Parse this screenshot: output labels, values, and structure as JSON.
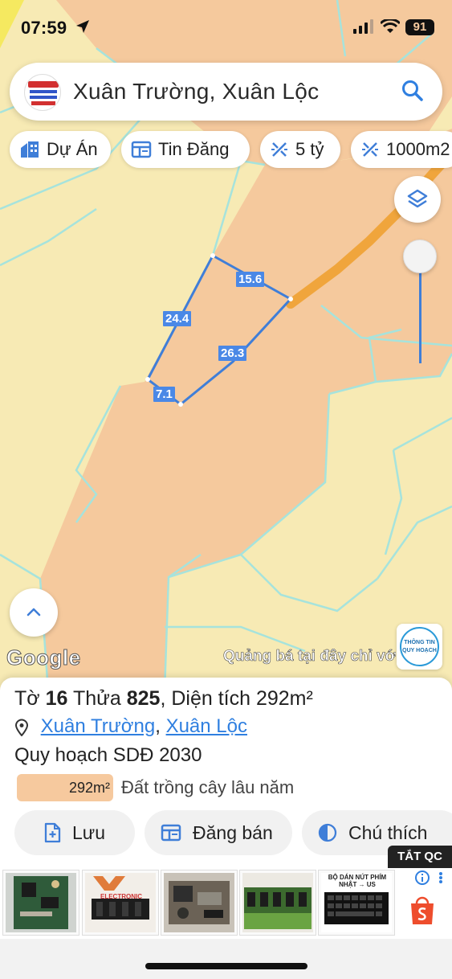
{
  "status_bar": {
    "time": "07:59",
    "battery": "91"
  },
  "search": {
    "title": "Xuân Trường, Xuân Lộc"
  },
  "chips": [
    {
      "label": "Dự Án",
      "icon": "building-icon"
    },
    {
      "label": "Tin Đăng",
      "icon": "newspaper-icon"
    },
    {
      "label": "5 tỷ",
      "icon": "price-filter-icon"
    },
    {
      "label": "1000m2",
      "icon": "area-filter-icon"
    }
  ],
  "map": {
    "edge_labels": [
      "15.6",
      "24.4",
      "26.3",
      "7.1"
    ],
    "attribution": "Google",
    "promo": "Quảng bá tại đây chỉ với",
    "info_button": {
      "line1": "THÔNG TIN",
      "line2": "QUY HOẠCH"
    },
    "colors": {
      "land": "#f5c99d",
      "background": "#f7eab4",
      "road": "#f0a53c",
      "parcel_edge": "#3f7ed8",
      "boundary": "#a6e3dc"
    }
  },
  "parcel": {
    "sheet_label": "Tờ",
    "sheet_no": "16",
    "plot_label": "Thửa",
    "plot_no": "825",
    "area_label": "Diện tích",
    "area": "292m²"
  },
  "address": {
    "ward": "Xuân Trường",
    "district": "Xuân Lộc"
  },
  "planning": {
    "title": "Quy hoạch SDĐ 2030",
    "area": "292m²",
    "land_use": "Đất trồng cây lâu năm",
    "color": "#f6c99e"
  },
  "actions": [
    {
      "label": "Lưu",
      "icon": "file-add-icon"
    },
    {
      "label": "Đăng bán",
      "icon": "post-icon"
    },
    {
      "label": "Chú thích",
      "icon": "contrast-icon"
    }
  ],
  "ads": {
    "close_label": "TẮT QC",
    "items": [
      "circuit-board",
      "electronic-parts",
      "power-supply-board",
      "ram-module",
      "laptop-keyboard"
    ],
    "captions": [
      "ELECTRONIC",
      "BỘ DÁN NÚT PHÍM NHẬT → US"
    ],
    "shop_icon": "shopee-icon"
  }
}
